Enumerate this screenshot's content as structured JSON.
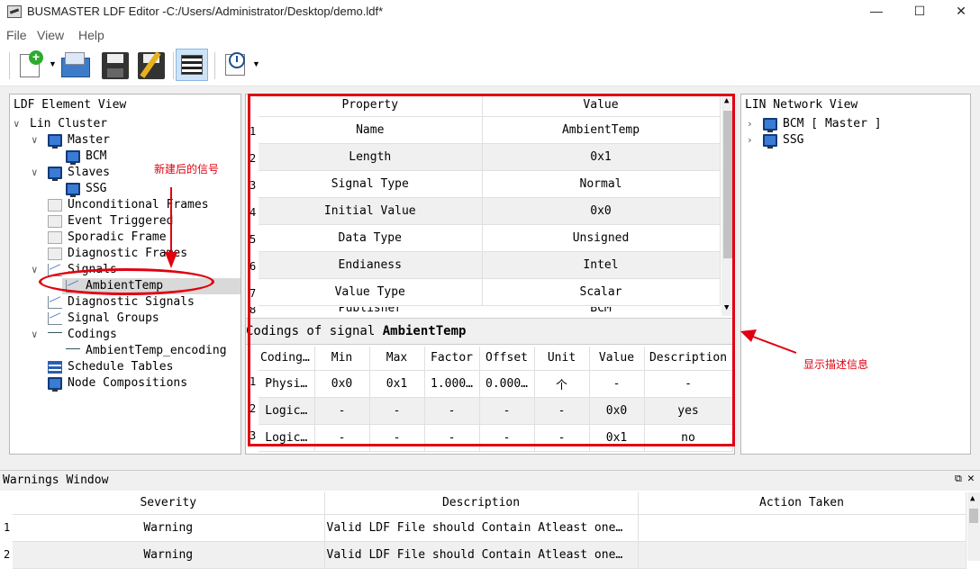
{
  "window": {
    "title": "BUSMASTER LDF Editor -C:/Users/Administrator/Desktop/demo.ldf*",
    "minimize": "—",
    "maximize": "☐",
    "close": "✕"
  },
  "menu": {
    "file": "File",
    "view": "View",
    "help": "Help"
  },
  "tree": {
    "title": "LDF Element View",
    "items": {
      "lin_cluster": "Lin Cluster",
      "master": "Master",
      "bcm": "BCM",
      "slaves": "Slaves",
      "ssg": "SSG",
      "unconditional_frames": "Unconditional Frames",
      "event_triggered": "Event Triggered",
      "sporadic_frame": "Sporadic Frame",
      "diagnostic_frames": "Diagnostic Frames",
      "signals": "Signals",
      "ambient_temp": "AmbientTemp",
      "diagnostic_signals": "Diagnostic Signals",
      "signal_groups": "Signal Groups",
      "codings": "Codings",
      "ambient_temp_encoding": "AmbientTemp_encoding",
      "schedule_tables": "Schedule Tables",
      "node_compositions": "Node Compositions"
    }
  },
  "properties": {
    "headers": [
      "Property",
      "Value"
    ],
    "rows": [
      {
        "n": "1",
        "prop": "Name",
        "value": "AmbientTemp"
      },
      {
        "n": "2",
        "prop": "Length",
        "value": "0x1"
      },
      {
        "n": "3",
        "prop": "Signal Type",
        "value": "Normal"
      },
      {
        "n": "4",
        "prop": "Initial Value",
        "value": "0x0"
      },
      {
        "n": "5",
        "prop": "Data Type",
        "value": "Unsigned"
      },
      {
        "n": "6",
        "prop": "Endianess",
        "value": "Intel"
      },
      {
        "n": "7",
        "prop": "Value Type",
        "value": "Scalar"
      },
      {
        "n": "8",
        "prop": "Publisher",
        "value": "BCM"
      }
    ]
  },
  "codings": {
    "title_prefix": "Codings of signal ",
    "signal_name": "AmbientTemp",
    "headers": [
      "Coding T",
      "Min",
      "Max",
      "Factor",
      "Offset",
      "Unit",
      "Value",
      "Description"
    ],
    "rows": [
      {
        "n": "1",
        "cells": [
          "Physi…",
          "0x0",
          "0x1",
          "1.000…",
          "0.000…",
          "个",
          "-",
          "-"
        ]
      },
      {
        "n": "2",
        "cells": [
          "Logic…",
          "-",
          "-",
          "-",
          "-",
          "-",
          "0x0",
          "yes"
        ]
      },
      {
        "n": "3",
        "cells": [
          "Logic…",
          "-",
          "-",
          "-",
          "-",
          "-",
          "0x1",
          "no"
        ]
      }
    ]
  },
  "network": {
    "title": "LIN Network View",
    "items": [
      "BCM [ Master ]",
      "SSG"
    ]
  },
  "warnings": {
    "title": "Warnings Window",
    "headers": [
      "Severity",
      "Description",
      "Action Taken"
    ],
    "rows": [
      {
        "n": "1",
        "severity": "Warning",
        "description": "Valid LDF File should Contain Atleast one…",
        "action": ""
      },
      {
        "n": "2",
        "severity": "Warning",
        "description": "Valid LDF File should Contain Atleast one…",
        "action": ""
      }
    ]
  },
  "annotations": {
    "new_signal": "新建后的信号",
    "show_description": "显示描述信息"
  },
  "colors": {
    "highlight": "#e00010"
  }
}
